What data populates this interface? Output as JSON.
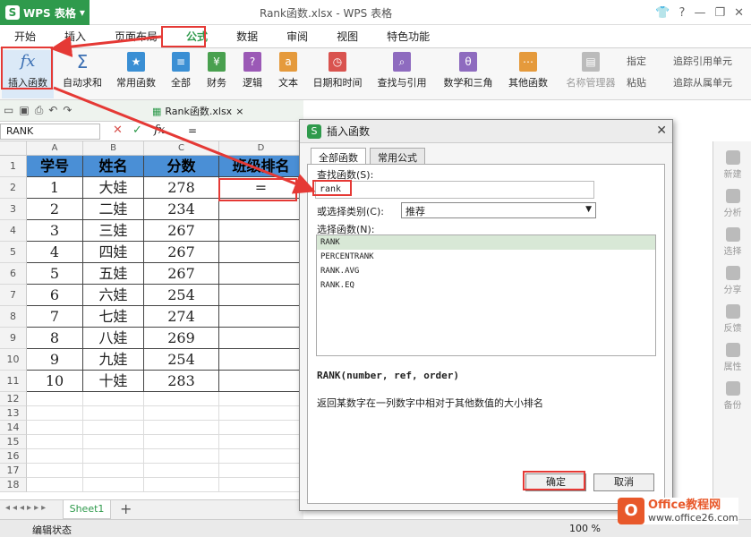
{
  "app": {
    "name": "WPS 表格",
    "doc_title": "Rank函数.xlsx - WPS 表格"
  },
  "menu": [
    "开始",
    "插入",
    "页面布局",
    "公式",
    "数据",
    "审阅",
    "视图",
    "特色功能"
  ],
  "ribbon": {
    "buttons": [
      {
        "label": "插入函数",
        "icon": "fx-icon"
      },
      {
        "label": "自动求和",
        "icon": "sigma-icon"
      },
      {
        "label": "常用函数",
        "icon": "star-book-icon",
        "color": "#3a8fd4"
      },
      {
        "label": "全部",
        "icon": "book-icon",
        "color": "#3a8fd4"
      },
      {
        "label": "财务",
        "icon": "finance-book-icon",
        "color": "#49a04f"
      },
      {
        "label": "逻辑",
        "icon": "question-book-icon",
        "color": "#9b59b6"
      },
      {
        "label": "文本",
        "icon": "text-book-icon",
        "color": "#e59a3c"
      },
      {
        "label": "日期和时间",
        "icon": "clock-book-icon",
        "color": "#d9534f"
      },
      {
        "label": "查找与引用",
        "icon": "search-book-icon",
        "color": "#8e6bbf"
      },
      {
        "label": "数学和三角",
        "icon": "theta-book-icon",
        "color": "#8e6bbf"
      },
      {
        "label": "其他函数",
        "icon": "grid-book-icon",
        "color": "#e59a3c"
      },
      {
        "label": "名称管理器",
        "icon": "name-manager-icon"
      }
    ],
    "small": [
      "指定",
      "粘贴",
      "追踪引用单元",
      "追踪从属单元"
    ]
  },
  "file_tab": "Rank函数.xlsx",
  "name_box": "RANK",
  "formula": "=",
  "columns": [
    "A",
    "B",
    "C",
    "D"
  ],
  "rows": [
    "1",
    "2",
    "3",
    "4",
    "5",
    "6",
    "7",
    "8",
    "9",
    "10",
    "11",
    "12",
    "13",
    "14",
    "15",
    "16",
    "17",
    "18"
  ],
  "table": {
    "headers": [
      "学号",
      "姓名",
      "分数",
      "班级排名"
    ],
    "data": [
      [
        "1",
        "大娃",
        "278",
        "="
      ],
      [
        "2",
        "二娃",
        "234",
        ""
      ],
      [
        "3",
        "三娃",
        "267",
        ""
      ],
      [
        "4",
        "四娃",
        "267",
        ""
      ],
      [
        "5",
        "五娃",
        "267",
        ""
      ],
      [
        "6",
        "六娃",
        "254",
        ""
      ],
      [
        "7",
        "七娃",
        "274",
        ""
      ],
      [
        "8",
        "八娃",
        "269",
        ""
      ],
      [
        "9",
        "九娃",
        "254",
        ""
      ],
      [
        "10",
        "十娃",
        "283",
        ""
      ]
    ]
  },
  "sheet_tab": "Sheet1",
  "status": {
    "left": "编辑状态",
    "zoom": "100 %"
  },
  "right_panel": [
    "新建",
    "分析",
    "选择",
    "分享",
    "反馈",
    "属性",
    "备份"
  ],
  "dialog": {
    "title": "插入函数",
    "tabs": [
      "全部函数",
      "常用公式"
    ],
    "search_label": "查找函数(S):",
    "search_value": "rank",
    "category_label": "或选择类别(C):",
    "category_value": "推荐",
    "list_label": "选择函数(N):",
    "functions": [
      "RANK",
      "PERCENTRANK",
      "RANK.AVG",
      "RANK.EQ"
    ],
    "signature": "RANK(number, ref, order)",
    "description": "返回某数字在一列数字中相对于其他数值的大小排名",
    "ok": "确定",
    "cancel": "取消"
  },
  "watermark": {
    "brand": "Office教程网",
    "url": "www.office26.com"
  },
  "colors": {
    "accent": "#2f9a4c",
    "highlight": "#e53935",
    "table_header": "#4a8fd6"
  }
}
